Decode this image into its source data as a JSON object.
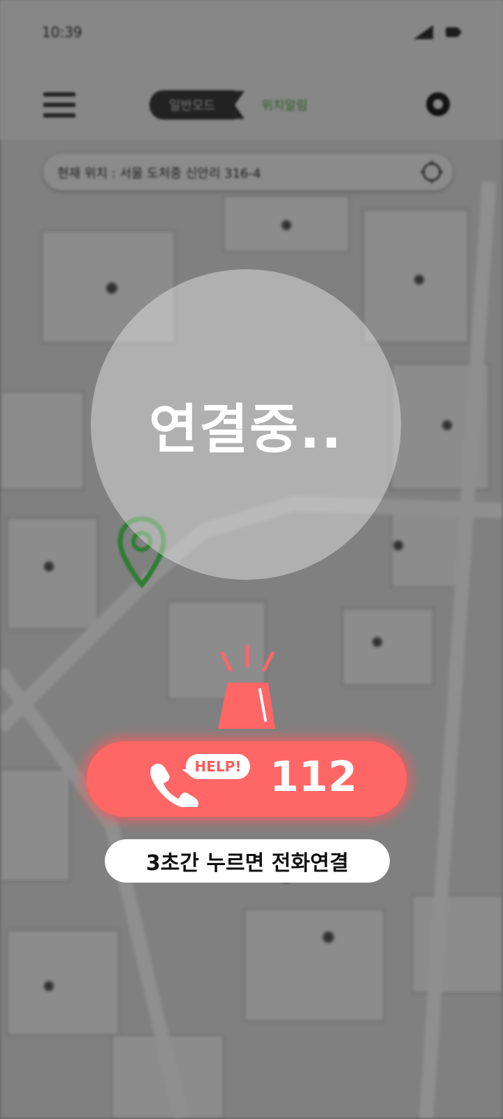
{
  "status_bar": {
    "time": "10:39"
  },
  "header": {
    "tab_active": "일반모드",
    "tab_inactive": "위치알림"
  },
  "search": {
    "address": "현재 위치 : 서울 도처중 신안리 316-4"
  },
  "overlay": {
    "connecting_text": "연결중.."
  },
  "emergency": {
    "help_bubble": "HELP!",
    "number": "112",
    "hint": "3초간 누르면 전화연결"
  },
  "colors": {
    "accent_red": "#ff6666",
    "pin_green": "#2e7d32",
    "tab_green": "#4a9a3a"
  }
}
